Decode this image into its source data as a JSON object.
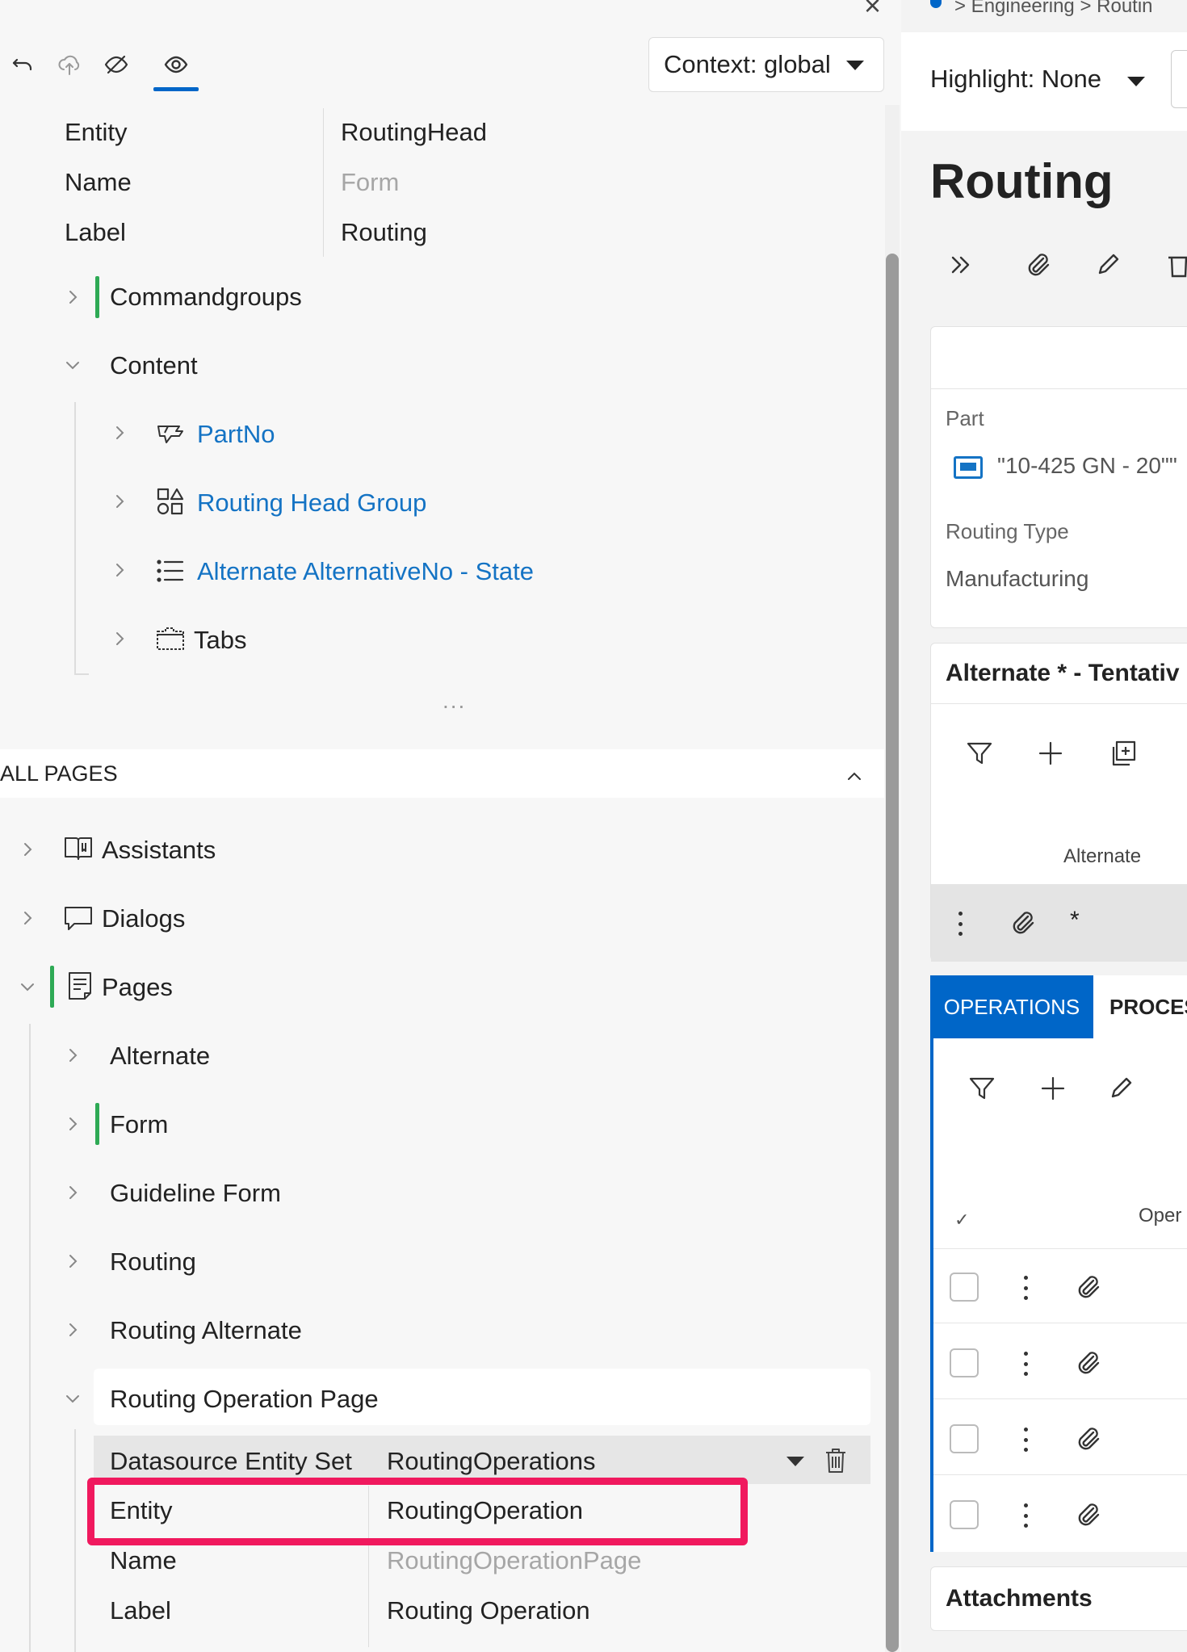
{
  "toolbar": {
    "context_label": "Context: global"
  },
  "properties": {
    "rows": [
      {
        "label": "Entity",
        "value": "RoutingHead",
        "muted": false
      },
      {
        "label": "Name",
        "value": "Form",
        "muted": true
      },
      {
        "label": "Label",
        "value": "Routing",
        "muted": false
      }
    ]
  },
  "tree": {
    "commandgroups": "Commandgroups",
    "content": "Content",
    "content_items": [
      "PartNo",
      "Routing Head Group",
      "Alternate AlternativeNo - State",
      "Tabs"
    ],
    "ellipsis": "..."
  },
  "all_pages": {
    "header": "ALL PAGES",
    "sections": [
      "Assistants",
      "Dialogs",
      "Pages"
    ],
    "pages": [
      "Alternate",
      "Form",
      "Guideline Form",
      "Routing",
      "Routing Alternate",
      "Routing Operation Page"
    ],
    "routing_operation_page": {
      "rows": [
        {
          "label": "Datasource Entity Set",
          "value": "RoutingOperations",
          "muted": false
        },
        {
          "label": "Entity",
          "value": "RoutingOperation",
          "muted": false
        },
        {
          "label": "Name",
          "value": "RoutingOperationPage",
          "muted": true
        },
        {
          "label": "Label",
          "value": "Routing Operation",
          "muted": false
        }
      ]
    }
  },
  "preview": {
    "breadcrumb": "> Engineering  > Routin",
    "highlight_label": "Highlight: None",
    "title": "Routing",
    "part_label": "Part",
    "part_value": "\"10-425 GN - 20\"\"",
    "routing_type_label": "Routing Type",
    "routing_type_value": "Manufacturing",
    "alternate_header": "Alternate * - Tentativ",
    "alternate_col": "Alternate",
    "alternate_star": "*",
    "tabs": [
      "OPERATIONS",
      "PROCES"
    ],
    "ops_column": "Oper",
    "check_mark": "✓",
    "attachments": "Attachments"
  },
  "colors": {
    "accent": "#0066c8",
    "link": "#1473c4",
    "green_marker": "#2eaa55",
    "highlight_box": "#f0195e"
  }
}
